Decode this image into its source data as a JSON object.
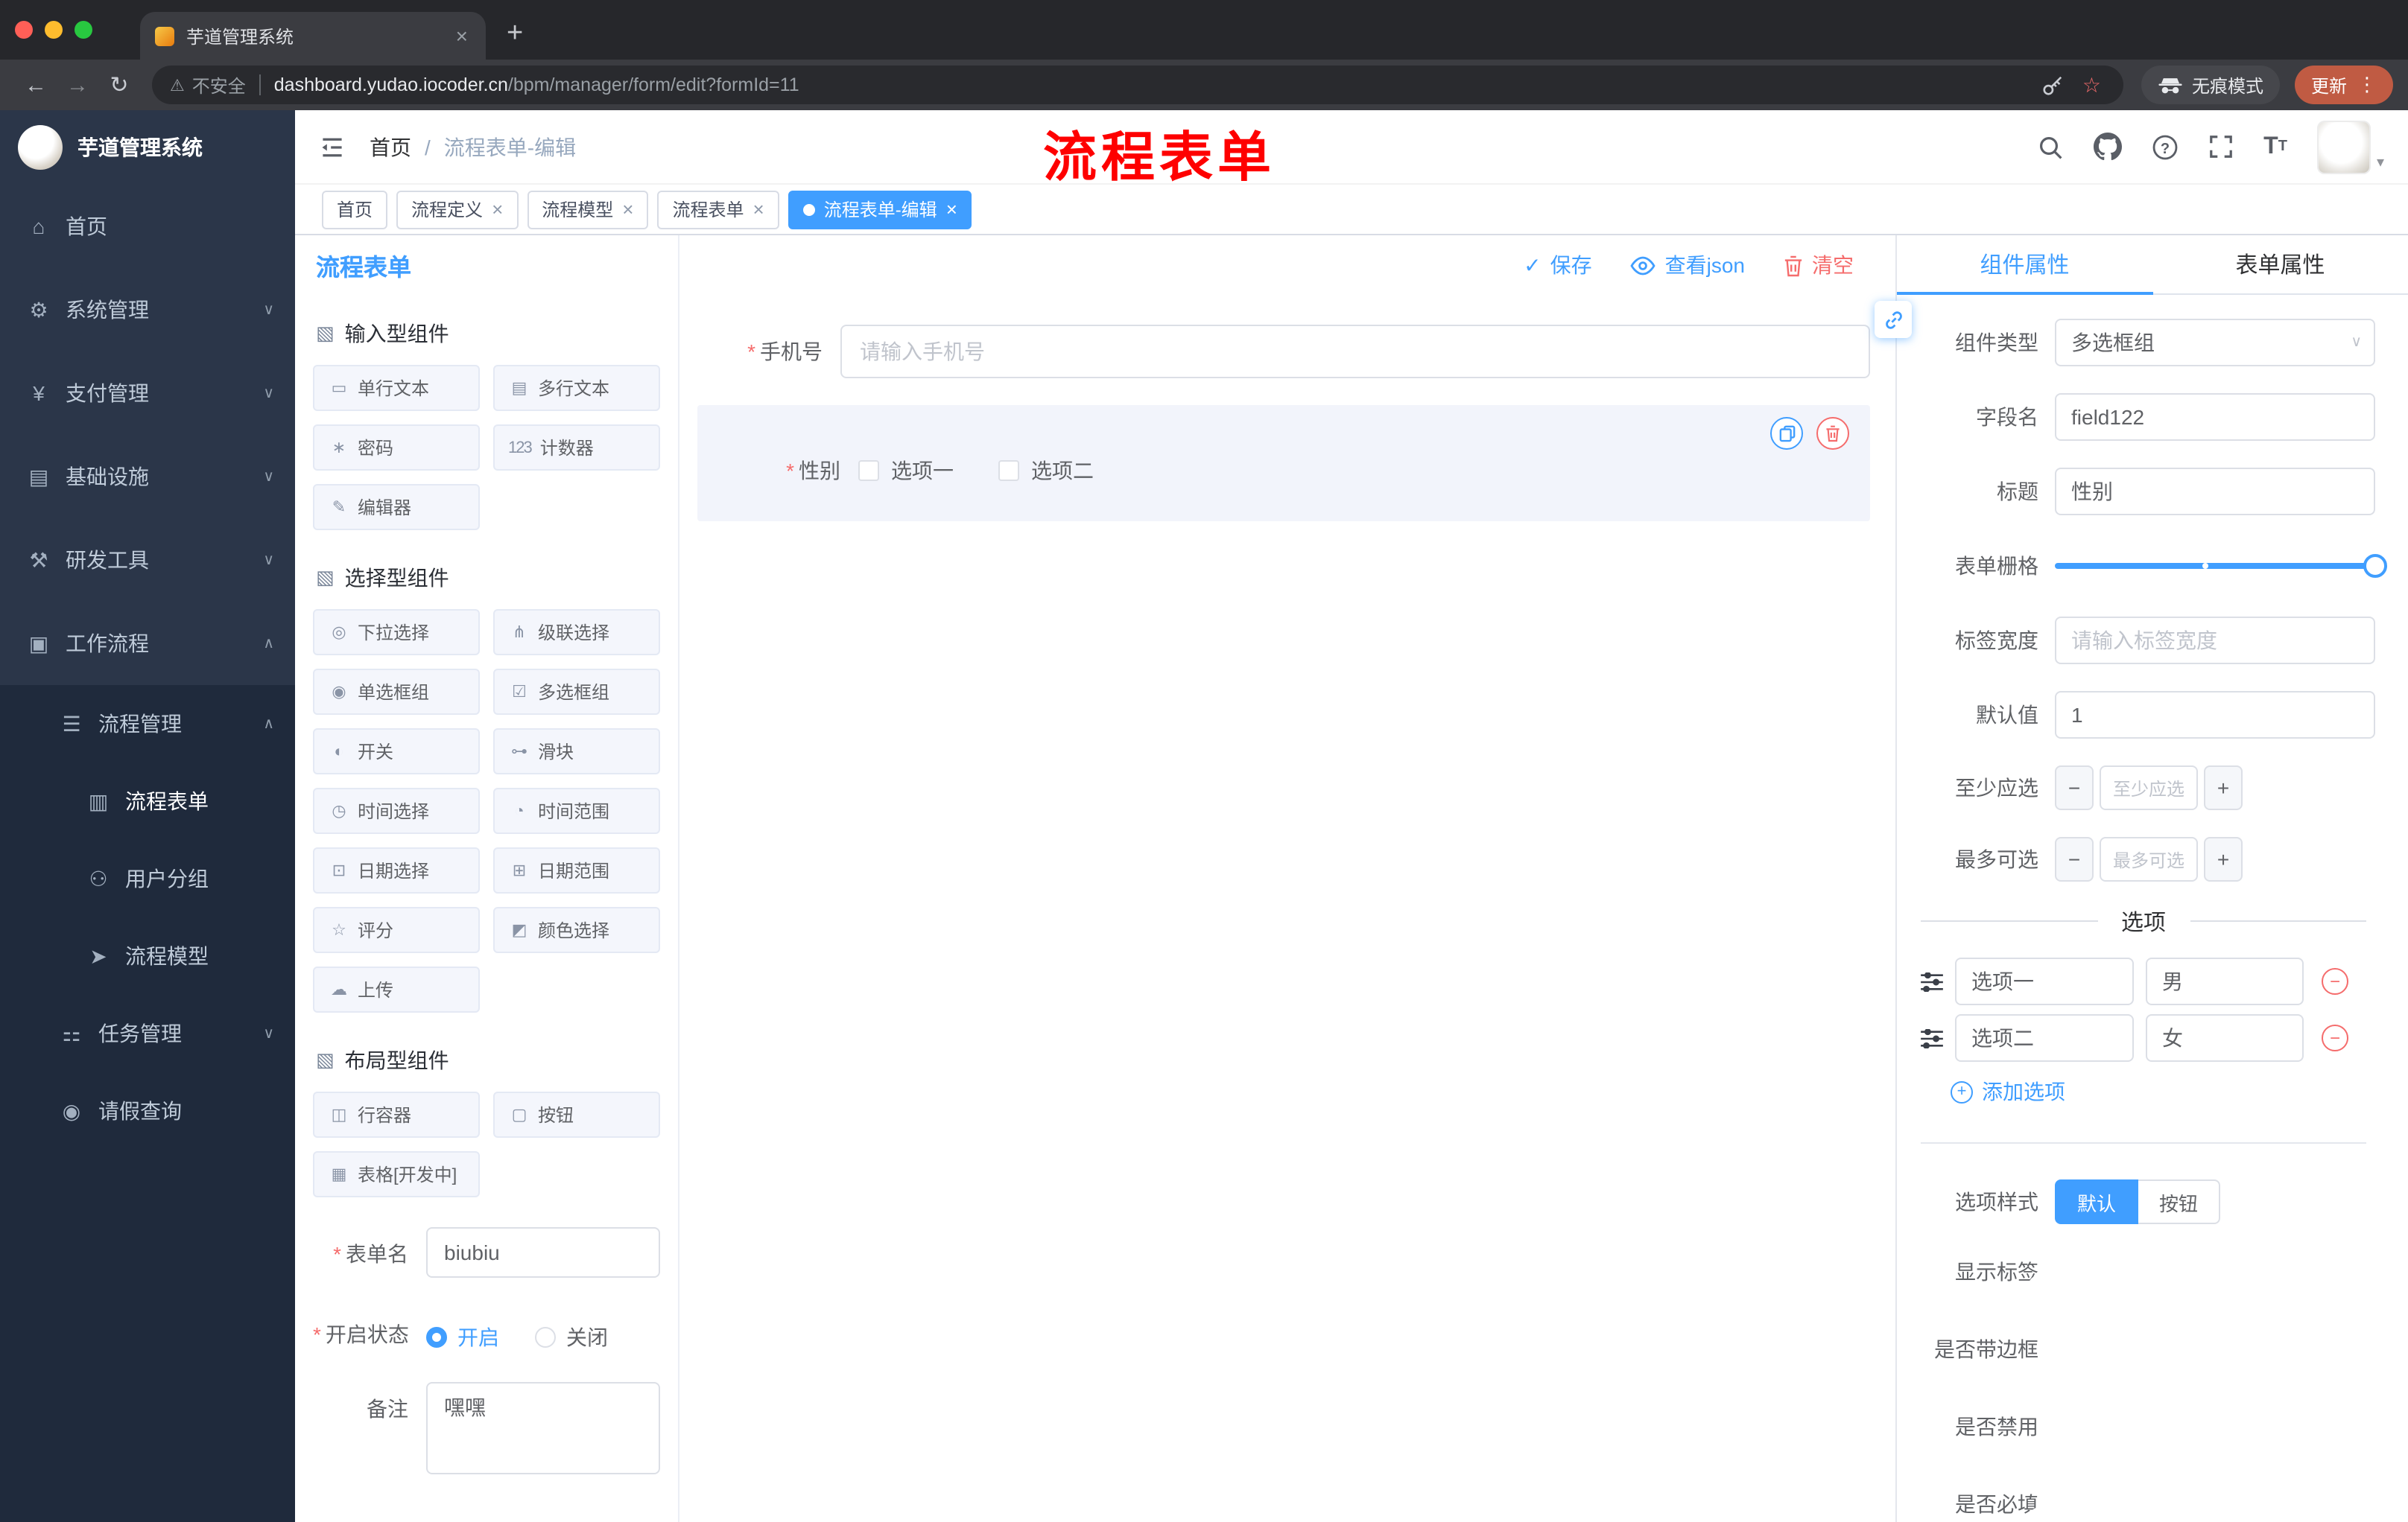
{
  "colors": {
    "accent": "#409eff",
    "danger": "#f56c6c",
    "annotation_red": "#fe0000"
  },
  "symbols": {
    "required": "*",
    "close": "×",
    "plus": "+",
    "minus": "−",
    "back": "←",
    "forward": "→",
    "reload": "↻",
    "warning": "⚠",
    "star": "☆",
    "dots": "⋮",
    "caret": "▾",
    "slash": "/",
    "chev_down": "∨",
    "chev_up": "∧",
    "check": "✓",
    "url_divider": "|"
  },
  "browser": {
    "tab_title": "芋道管理系统",
    "security_label": "不安全",
    "url_domain": "dashboard.yudao.iocoder.cn",
    "url_path": "/bpm/manager/form/edit?formId=11",
    "incognito_label": "无痕模式",
    "update_label": "更新"
  },
  "sidebar": {
    "logo_title": "芋道管理系统",
    "menu": [
      {
        "icon": "⌂",
        "label": "首页"
      },
      {
        "icon": "⚙",
        "label": "系统管理"
      },
      {
        "icon": "¥",
        "label": "支付管理"
      },
      {
        "icon": "▤",
        "label": "基础设施"
      },
      {
        "icon": "⚒",
        "label": "研发工具"
      },
      {
        "icon": "▣",
        "label": "工作流程"
      }
    ],
    "sub": [
      {
        "icon": "☰",
        "label": "流程管理"
      },
      {
        "icon": "▥",
        "label": "流程表单"
      },
      {
        "icon": "⚇",
        "label": "用户分组"
      },
      {
        "icon": "➤",
        "label": "流程模型"
      },
      {
        "icon": "⚏",
        "label": "任务管理"
      },
      {
        "icon": "◉",
        "label": "请假查询"
      }
    ]
  },
  "header": {
    "breadcrumb_home": "首页",
    "breadcrumb_current": "流程表单-编辑",
    "annotation": "流程表单"
  },
  "tags": [
    {
      "label": "首页"
    },
    {
      "label": "流程定义"
    },
    {
      "label": "流程模型"
    },
    {
      "label": "流程表单"
    },
    {
      "label": "流程表单-编辑"
    }
  ],
  "designer": {
    "title": "流程表单",
    "toolbar": {
      "save": "保存",
      "view_json": "查看json",
      "clear": "清空"
    },
    "palette": {
      "input_section": "输入型组件",
      "input_items": [
        {
          "icon": "▭",
          "label": "单行文本"
        },
        {
          "icon": "▤",
          "label": "多行文本"
        },
        {
          "icon": "∗",
          "label": "密码"
        },
        {
          "icon": "123",
          "label": "计数器"
        },
        {
          "icon": "✎",
          "label": "编辑器"
        }
      ],
      "select_section": "选择型组件",
      "select_items": [
        {
          "icon": "◎",
          "label": "下拉选择"
        },
        {
          "icon": "⋔",
          "label": "级联选择"
        },
        {
          "icon": "◉",
          "label": "单选框组"
        },
        {
          "icon": "☑",
          "label": "多选框组"
        },
        {
          "icon": "◐",
          "label": "开关"
        },
        {
          "icon": "⊶",
          "label": "滑块"
        },
        {
          "icon": "◷",
          "label": "时间选择"
        },
        {
          "icon": "◔",
          "label": "时间范围"
        },
        {
          "icon": "⊡",
          "label": "日期选择"
        },
        {
          "icon": "⊞",
          "label": "日期范围"
        },
        {
          "icon": "☆",
          "label": "评分"
        },
        {
          "icon": "◩",
          "label": "颜色选择"
        },
        {
          "icon": "☁",
          "label": "上传"
        }
      ],
      "layout_section": "布局型组件",
      "layout_items": [
        {
          "icon": "◫",
          "label": "行容器"
        },
        {
          "icon": "▢",
          "label": "按钮"
        },
        {
          "icon": "▦",
          "label": "表格[开发中]"
        }
      ]
    },
    "meta": {
      "name_label": "表单名",
      "name_value": "biubiu",
      "status_label": "开启状态",
      "status_on": "开启",
      "status_off": "关闭",
      "remark_label": "备注",
      "remark_value": "嘿嘿"
    },
    "canvas": {
      "phone_label": "手机号",
      "phone_placeholder": "请输入手机号",
      "gender_label": "性别",
      "gender_options": [
        "选项一",
        "选项二"
      ]
    }
  },
  "props": {
    "tab_component": "组件属性",
    "tab_form": "表单属性",
    "type_label": "组件类型",
    "type_value": "多选框组",
    "field_label": "字段名",
    "field_value": "field122",
    "title_label": "标题",
    "title_value": "性别",
    "grid_label": "表单栅格",
    "label_width_label": "标签宽度",
    "label_width_placeholder": "请输入标签宽度",
    "default_label": "默认值",
    "default_value": "1",
    "min_label": "至少应选",
    "min_placeholder": "至少应选",
    "max_label": "最多可选",
    "max_placeholder": "最多可选",
    "options_divider": "选项",
    "options": [
      {
        "label": "选项一",
        "value": "男"
      },
      {
        "label": "选项二",
        "value": "女"
      }
    ],
    "add_option": "添加选项",
    "style_label": "选项样式",
    "style_default": "默认",
    "style_button": "按钮",
    "show_label": "显示标签",
    "border_label": "是否带边框",
    "disabled_label": "是否禁用",
    "required_label": "是否必填"
  }
}
